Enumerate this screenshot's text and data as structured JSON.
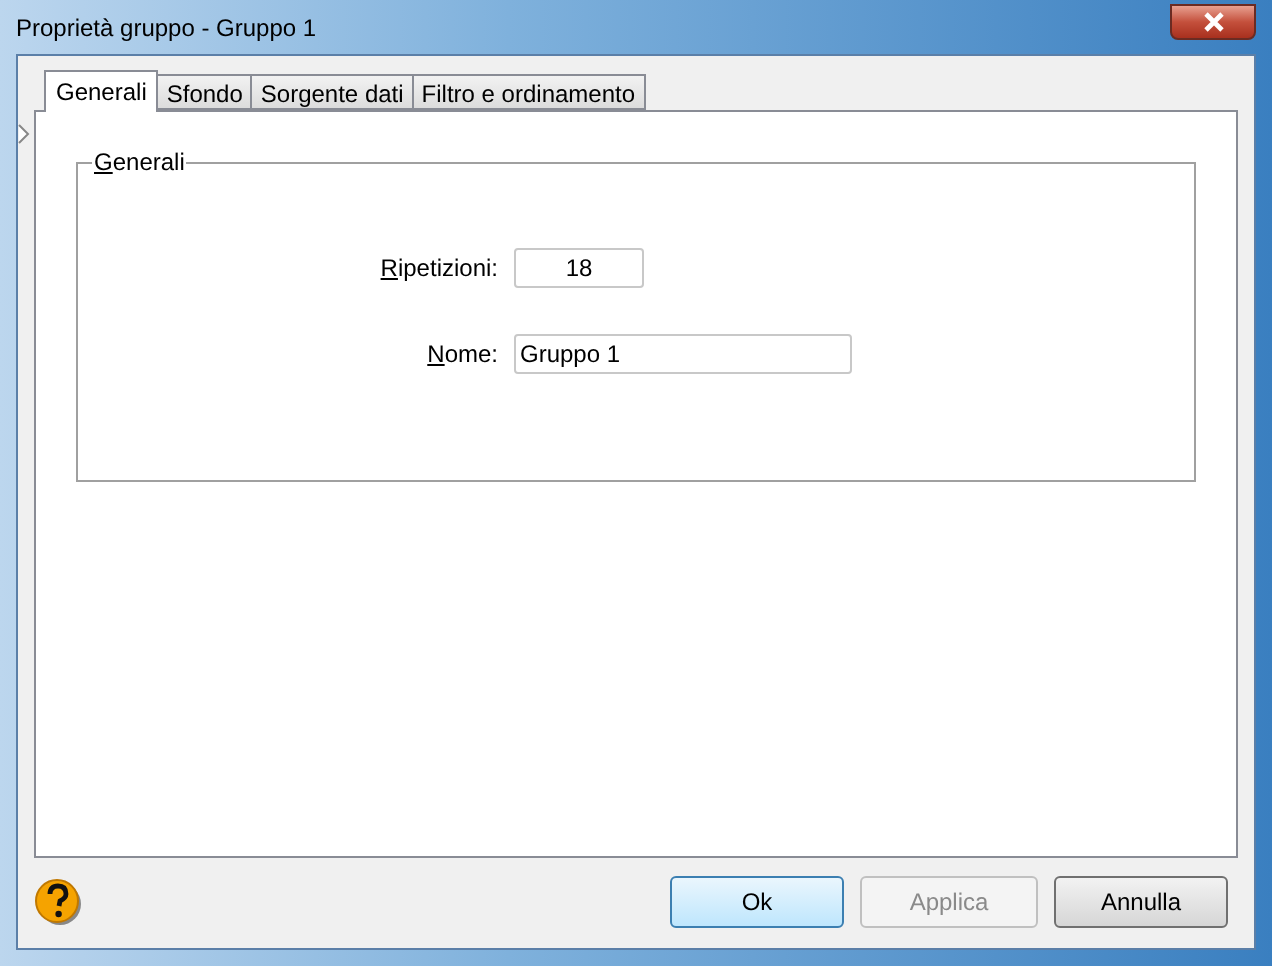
{
  "window": {
    "title": "Proprietà gruppo - Gruppo 1"
  },
  "tabs": [
    {
      "label": "Generali",
      "selected": true
    },
    {
      "label": "Sfondo",
      "selected": false
    },
    {
      "label": "Sorgente dati",
      "selected": false
    },
    {
      "label": "Filtro e ordinamento",
      "selected": false
    }
  ],
  "group": {
    "title": "Generali",
    "fields": [
      {
        "label": "Ripetizioni:",
        "value": "18",
        "kind": "number"
      },
      {
        "label": "Nome:",
        "value": "Gruppo 1",
        "kind": "text"
      }
    ]
  },
  "buttons": [
    {
      "label": "Ok",
      "default": true,
      "disabled": false
    },
    {
      "label": "Applica",
      "default": false,
      "disabled": true
    },
    {
      "label": "Annulla",
      "default": false,
      "disabled": false
    }
  ]
}
